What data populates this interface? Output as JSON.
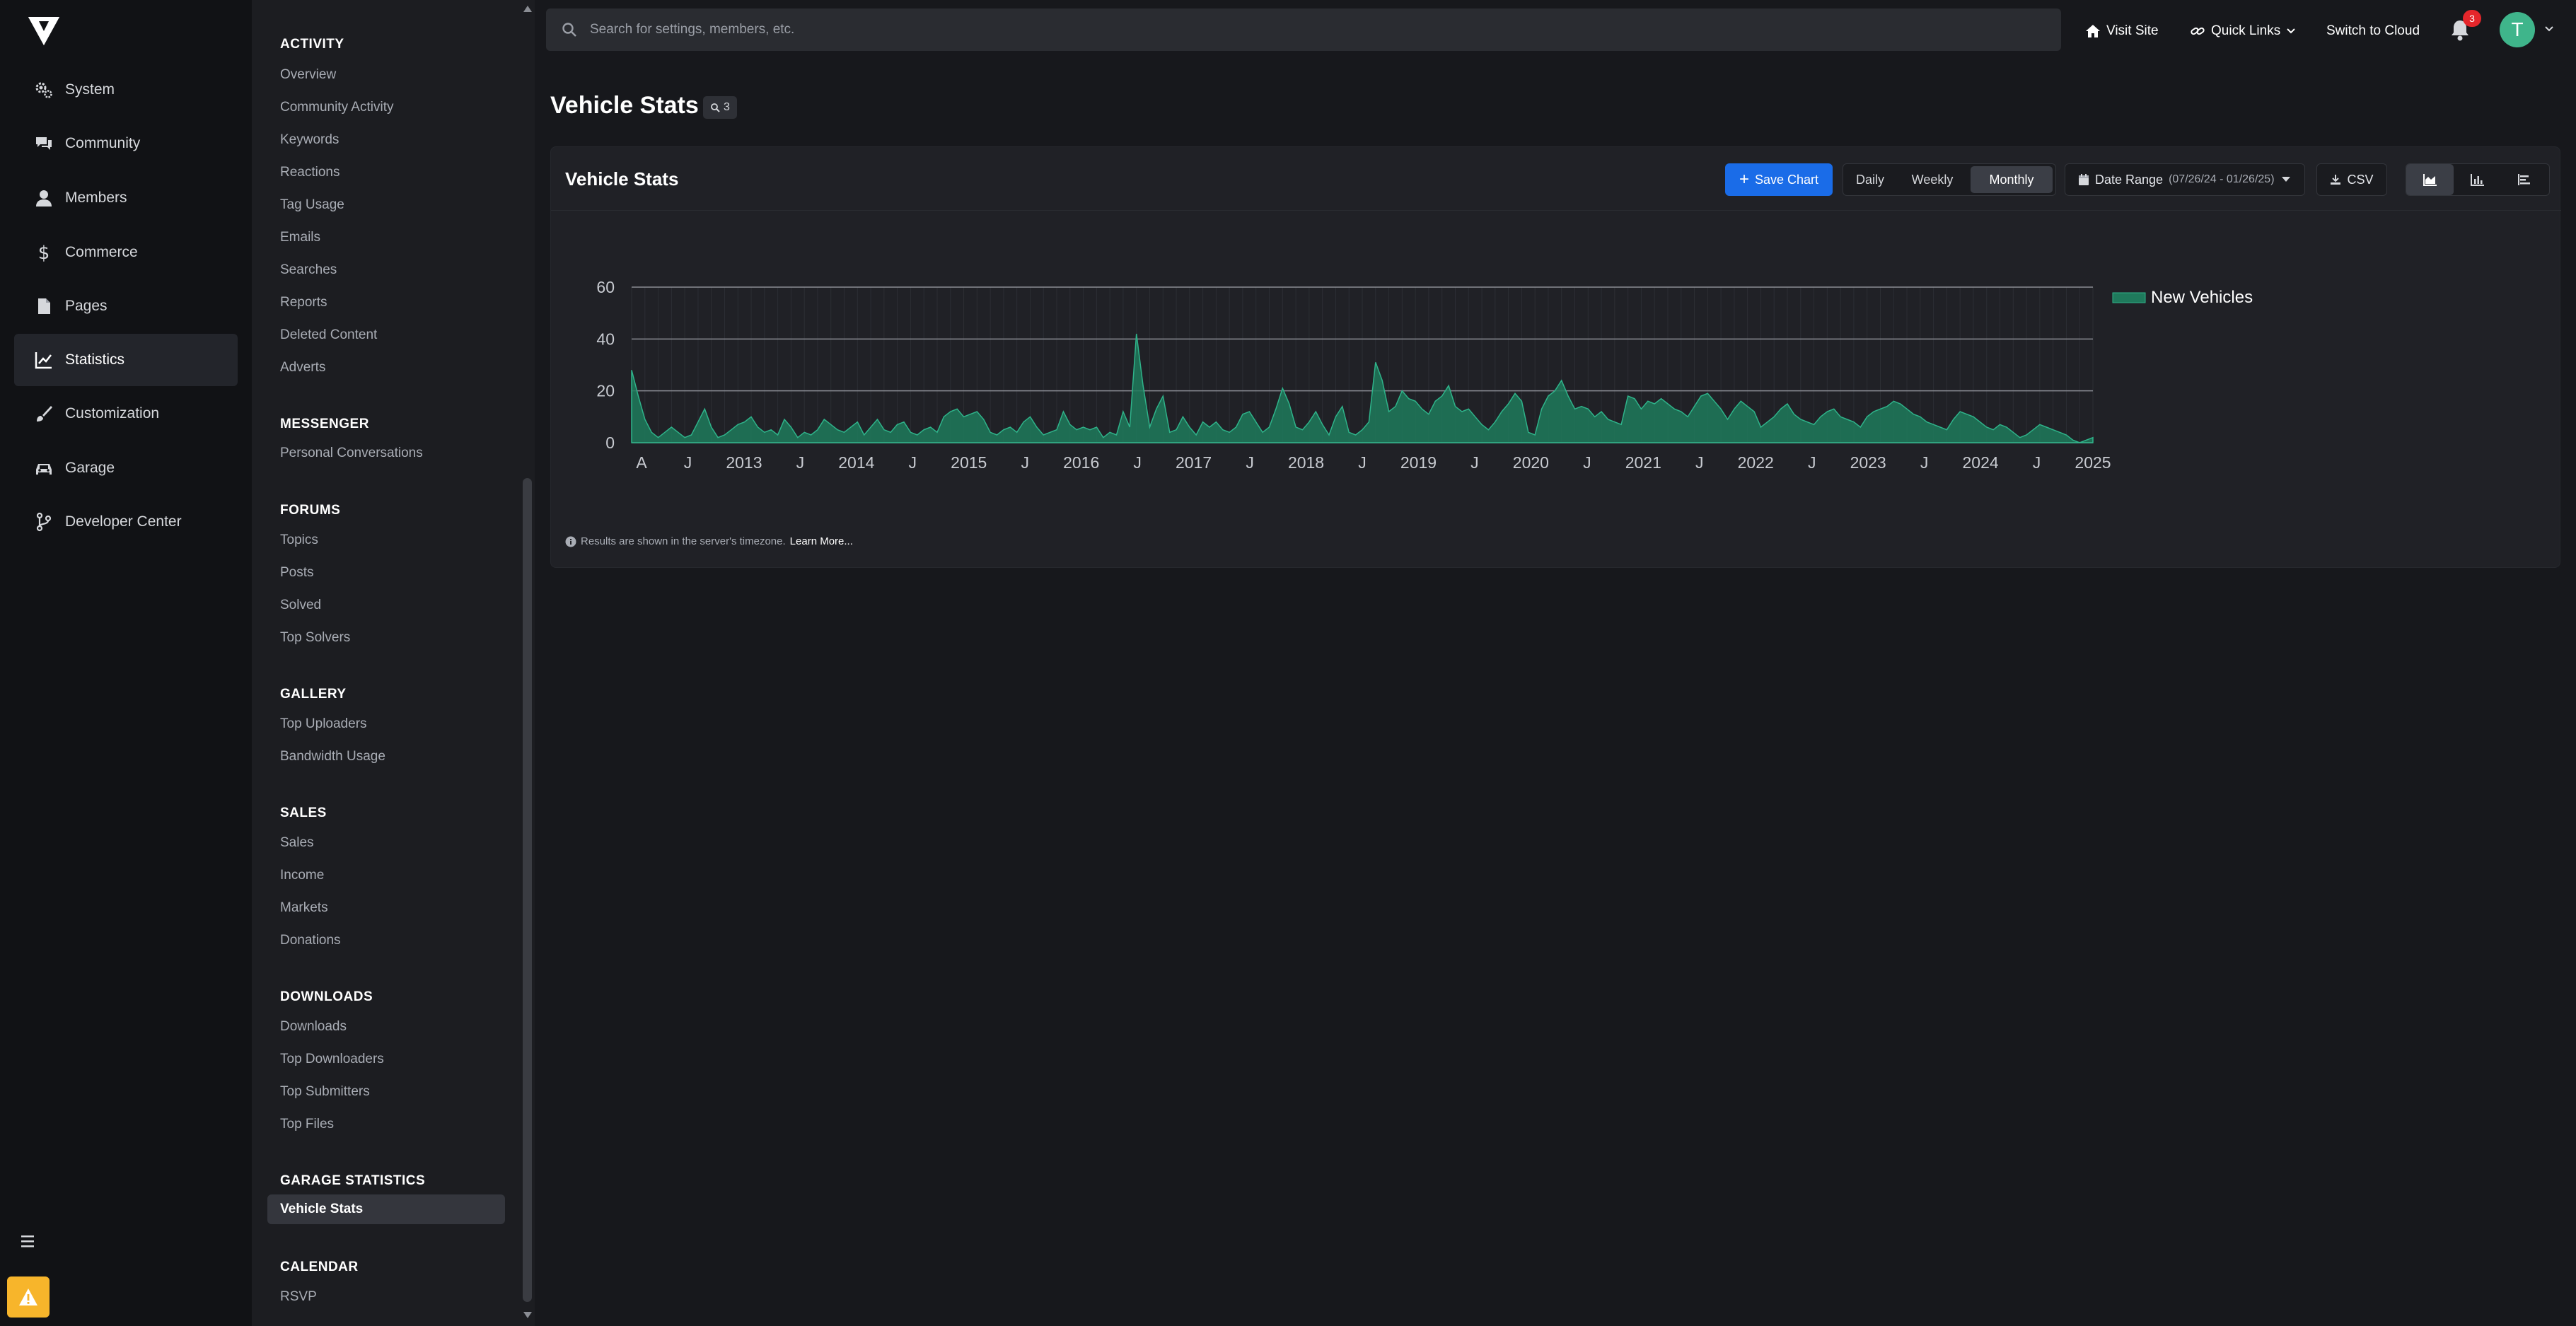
{
  "search": {
    "placeholder": "Search for settings, members, etc."
  },
  "topbar": {
    "visit_site": "Visit Site",
    "quick_links": "Quick Links",
    "switch_to_cloud": "Switch to Cloud",
    "notifications_count": "3",
    "avatar_letter": "T"
  },
  "mainnav": {
    "items": [
      {
        "label": "System",
        "icon": "gears-icon"
      },
      {
        "label": "Community",
        "icon": "comments-icon"
      },
      {
        "label": "Members",
        "icon": "user-icon"
      },
      {
        "label": "Commerce",
        "icon": "dollar-icon"
      },
      {
        "label": "Pages",
        "icon": "file-icon"
      },
      {
        "label": "Statistics",
        "icon": "chart-line-icon",
        "active": true
      },
      {
        "label": "Customization",
        "icon": "brush-icon"
      },
      {
        "label": "Garage",
        "icon": "car-icon"
      },
      {
        "label": "Developer Center",
        "icon": "branch-icon"
      }
    ]
  },
  "subnav": {
    "sections": [
      {
        "title": "ACTIVITY",
        "links": [
          "Overview",
          "Community Activity",
          "Keywords",
          "Reactions",
          "Tag Usage",
          "Emails",
          "Searches",
          "Reports",
          "Deleted Content",
          "Adverts"
        ]
      },
      {
        "title": "MESSENGER",
        "links": [
          "Personal Conversations"
        ]
      },
      {
        "title": "FORUMS",
        "links": [
          "Topics",
          "Posts",
          "Solved",
          "Top Solvers"
        ]
      },
      {
        "title": "GALLERY",
        "links": [
          "Top Uploaders",
          "Bandwidth Usage"
        ]
      },
      {
        "title": "SALES",
        "links": [
          "Sales",
          "Income",
          "Markets",
          "Donations"
        ]
      },
      {
        "title": "DOWNLOADS",
        "links": [
          "Downloads",
          "Top Downloaders",
          "Top Submitters",
          "Top Files"
        ]
      },
      {
        "title": "GARAGE STATISTICS",
        "links": [
          "Vehicle Stats"
        ]
      },
      {
        "title": "CALENDAR",
        "links": [
          "RSVP"
        ]
      }
    ],
    "active_link": "Vehicle Stats"
  },
  "page": {
    "title": "Vehicle Stats",
    "search_count": "3"
  },
  "card": {
    "title": "Vehicle Stats",
    "save_chart": "Save Chart",
    "timescale": [
      "Daily",
      "Weekly",
      "Monthly"
    ],
    "timescale_selected": "Monthly",
    "date_range_label": "Date Range",
    "date_range_value": "(07/26/24 - 01/26/25)",
    "csv": "CSV",
    "footnote": "Results are shown in the server's timezone.",
    "learn_more": "Learn More..."
  },
  "colors": {
    "accent": "#1a6ce8",
    "series": "#1f7a5c",
    "series_line": "#2fb38a",
    "warning": "#f7b52b"
  },
  "chart_data": {
    "type": "area",
    "title": "",
    "xlabel": "",
    "ylabel": "",
    "ylim": [
      0,
      60
    ],
    "yticks": [
      0,
      20,
      40,
      60
    ],
    "x_tick_labels": [
      "A",
      "J",
      "2013",
      "J",
      "2014",
      "J",
      "2015",
      "J",
      "2016",
      "J",
      "2017",
      "J",
      "2018",
      "J",
      "2019",
      "J",
      "2020",
      "J",
      "2021",
      "J",
      "2022",
      "J",
      "2023",
      "J",
      "2024",
      "J",
      "2025"
    ],
    "legend_position": "right",
    "grid": true,
    "series": [
      {
        "name": "New Vehicles",
        "start": "2012-08",
        "frequency": "monthly",
        "values": [
          28,
          18,
          9,
          4,
          2,
          4,
          6,
          4,
          2,
          3,
          8,
          13,
          6,
          2,
          3,
          5,
          7,
          8,
          10,
          6,
          4,
          5,
          3,
          9,
          6,
          2,
          4,
          3,
          5,
          9,
          7,
          5,
          4,
          6,
          8,
          3,
          6,
          9,
          5,
          4,
          7,
          8,
          4,
          3,
          5,
          6,
          4,
          10,
          12,
          13,
          10,
          11,
          12,
          9,
          4,
          3,
          5,
          6,
          4,
          8,
          10,
          6,
          3,
          4,
          5,
          12,
          7,
          5,
          6,
          5,
          6,
          2,
          4,
          3,
          12,
          6,
          42,
          22,
          6,
          13,
          18,
          4,
          5,
          10,
          6,
          3,
          8,
          6,
          8,
          5,
          4,
          6,
          11,
          12,
          8,
          4,
          6,
          13,
          21,
          15,
          6,
          5,
          8,
          12,
          7,
          3,
          10,
          14,
          4,
          3,
          5,
          8,
          31,
          24,
          12,
          14,
          20,
          17,
          16,
          13,
          11,
          16,
          18,
          22,
          14,
          12,
          13,
          10,
          7,
          5,
          8,
          12,
          15,
          19,
          16,
          4,
          3,
          13,
          18,
          20,
          24,
          18,
          13,
          14,
          13,
          10,
          12,
          9,
          8,
          7,
          18,
          17,
          13,
          16,
          15,
          17,
          15,
          13,
          12,
          10,
          14,
          18,
          19,
          16,
          13,
          9,
          13,
          16,
          14,
          12,
          6,
          8,
          10,
          13,
          15,
          11,
          9,
          8,
          7,
          10,
          12,
          13,
          10,
          9,
          8,
          6,
          10,
          12,
          13,
          14,
          16,
          15,
          13,
          11,
          10,
          8,
          7,
          6,
          5,
          9,
          12,
          11,
          10,
          8,
          6,
          5,
          7,
          6,
          4,
          2,
          3,
          5,
          7,
          6,
          5,
          4,
          3,
          1,
          0,
          1,
          2
        ]
      }
    ]
  }
}
